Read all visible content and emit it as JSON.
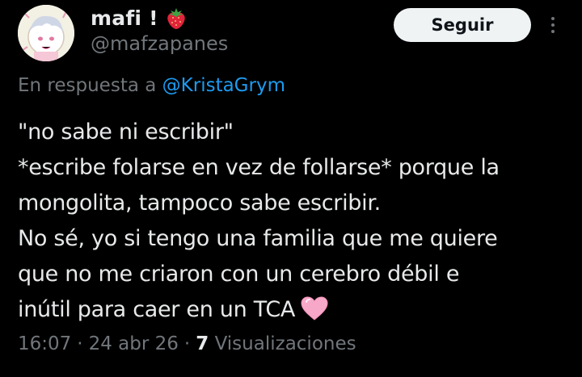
{
  "author": {
    "display_name": "mafi !",
    "handle": "@mafzapanes",
    "name_emoji": "strawberry-icon",
    "avatar": "avatar"
  },
  "follow_button": {
    "label": "Seguir"
  },
  "more_menu": {
    "icon": "more-vertical-icon"
  },
  "reply": {
    "prefix": "En respuesta a",
    "mention": "@KristaGrym"
  },
  "tweet": {
    "text": "\"no sabe ni escribir\"\n*escribe folarse en vez de follarse* porque la\nmongolita, tampoco sabe escribir.\nNo sé, yo si tengo una familia que me quiere\nque no me criaron con un cerebro débil e\ninútil para caer en un TCA",
    "trailing_emoji": "pink-heart-icon"
  },
  "meta": {
    "time": "16:07",
    "sep1": "·",
    "date": "24 abr 26",
    "sep2": "·",
    "views_count": "7",
    "views_label": "Visualizaciones"
  },
  "colors": {
    "background": "#000000",
    "text": "#e7e9ea",
    "muted": "#71767b",
    "link": "#1d9bf0",
    "button_bg": "#eff3f4"
  }
}
